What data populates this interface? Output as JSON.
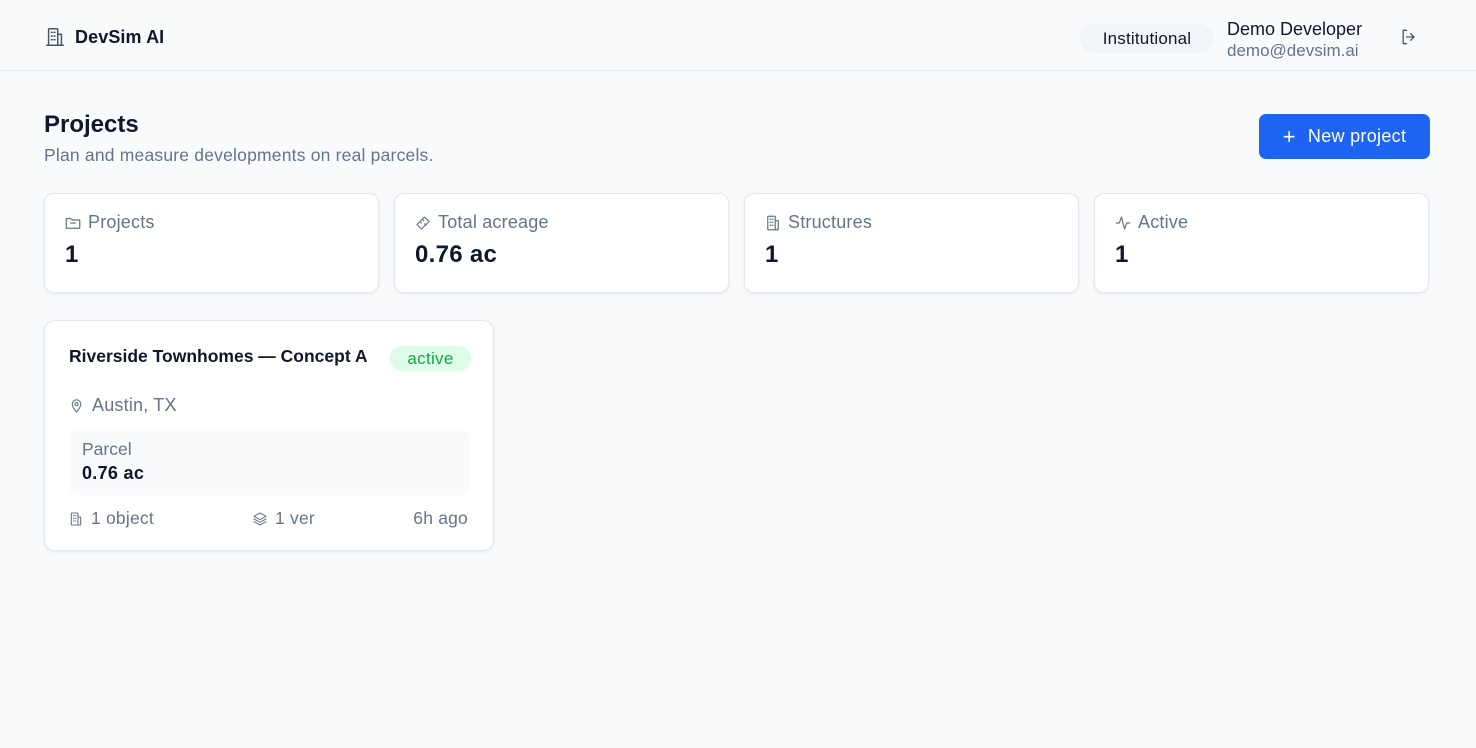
{
  "header": {
    "brand": {
      "name": "DevSim AI",
      "icon": "building-icon"
    },
    "plan_badge": "Institutional",
    "user": {
      "name": "Demo Developer",
      "email": "demo@devsim.ai"
    },
    "logout_icon": "logout-icon"
  },
  "page": {
    "title": "Projects",
    "subtitle": "Plan and measure developments on real parcels.",
    "new_project_label": "New project"
  },
  "stats": [
    {
      "label": "Projects",
      "value": "1",
      "icon": "folder-icon"
    },
    {
      "label": "Total acreage",
      "value": "0.76 ac",
      "icon": "ruler-icon"
    },
    {
      "label": "Structures",
      "value": "1",
      "icon": "building-icon"
    },
    {
      "label": "Active",
      "value": "1",
      "icon": "activity-icon"
    }
  ],
  "projects": [
    {
      "title": "Riverside Townhomes — Concept A",
      "status": "active",
      "location": "Austin, TX",
      "parcel_label": "Parcel",
      "parcel_value": "0.76 ac",
      "objects": "1 object",
      "versions": "1 ver",
      "updated": "6h ago"
    }
  ],
  "colors": {
    "accent": "#1d64f2",
    "background": "#f8fafc",
    "status_active_bg": "#dcfce7",
    "status_active_text": "#16a34a",
    "muted_text": "#64748b"
  }
}
